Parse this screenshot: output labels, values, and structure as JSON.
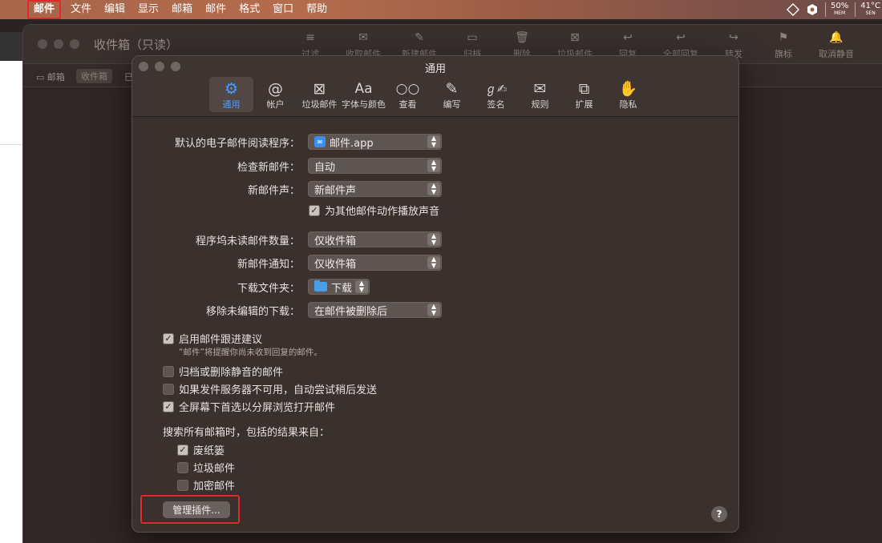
{
  "menubar": {
    "app_name": "邮件",
    "items": [
      "文件",
      "编辑",
      "显示",
      "邮箱",
      "邮件",
      "格式",
      "窗口",
      "帮助"
    ],
    "mem_value": "50%",
    "mem_label": "MEM",
    "sen_value": "41°C",
    "sen_label": "SEN"
  },
  "mail_window": {
    "title": "收件箱（只读）",
    "toolbar": [
      "过滤",
      "收取邮件",
      "新建邮件",
      "归档",
      "删除",
      "垃圾邮件",
      "回复",
      "全部回复",
      "转发",
      "旗标",
      "取消静音"
    ],
    "subbar": {
      "mailbox_label": "邮箱",
      "inbox_tag": "收件箱",
      "sent_prefix": "已"
    }
  },
  "prefs": {
    "title": "通用",
    "tabs": [
      {
        "label": "通用",
        "icon": "gear-icon"
      },
      {
        "label": "帐户",
        "icon": "at-icon"
      },
      {
        "label": "垃圾邮件",
        "icon": "junk-icon"
      },
      {
        "label": "字体与颜色",
        "icon": "font-icon"
      },
      {
        "label": "查看",
        "icon": "glasses-icon"
      },
      {
        "label": "编写",
        "icon": "compose-icon"
      },
      {
        "label": "签名",
        "icon": "signature-icon"
      },
      {
        "label": "规则",
        "icon": "rules-icon"
      },
      {
        "label": "扩展",
        "icon": "puzzle-icon"
      },
      {
        "label": "隐私",
        "icon": "hand-icon"
      }
    ],
    "default_reader_label": "默认的电子邮件阅读程序：",
    "default_reader_value": "邮件.app",
    "check_mail_label": "检查新邮件：",
    "check_mail_value": "自动",
    "new_mail_sound_label": "新邮件声：",
    "new_mail_sound_value": "新邮件声",
    "play_sounds_label": "为其他邮件动作播放声音",
    "dock_count_label": "程序坞未读邮件数量：",
    "dock_count_value": "仅收件箱",
    "notify_label": "新邮件通知：",
    "notify_value": "仅收件箱",
    "downloads_label": "下载文件夹：",
    "downloads_value": "下载",
    "remove_downloads_label": "移除未编辑的下载：",
    "remove_downloads_value": "在邮件被删除后",
    "follow_up_label": "启用邮件跟进建议",
    "follow_up_hint": "“邮件”将提醒你尚未收到回复的邮件。",
    "archive_muted_label": "归档或删除静音的邮件",
    "retry_send_label": "如果发件服务器不可用，自动尝试稍后发送",
    "split_view_label": "全屏幕下首选以分屏浏览打开邮件",
    "search_section_label": "搜索所有邮箱时，包括的结果来自：",
    "search_trash_label": "废纸篓",
    "search_junk_label": "垃圾邮件",
    "search_encrypted_label": "加密邮件",
    "manage_plugins_label": "管理插件...",
    "help_label": "?"
  }
}
